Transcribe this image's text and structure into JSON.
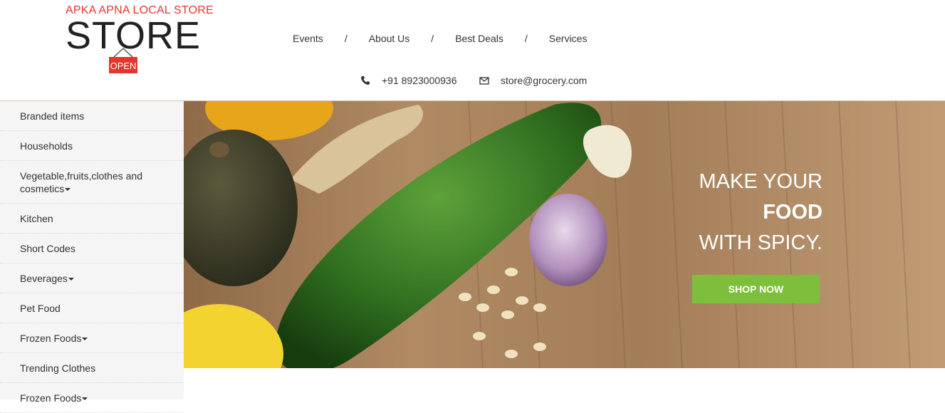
{
  "brand": {
    "tagline": "APKA APNA LOCAL STORE",
    "name": "STORE",
    "sign_text": "OPEN"
  },
  "nav": {
    "items": [
      "Events",
      "About Us",
      "Best Deals",
      "Services"
    ],
    "separator": "/"
  },
  "contact": {
    "phone": "+91 8923000936",
    "email": "store@grocery.com",
    "phone_icon": "phone-icon",
    "email_icon": "envelope-icon"
  },
  "sidebar": {
    "items": [
      {
        "label": "Branded items",
        "dropdown": false
      },
      {
        "label": "Households",
        "dropdown": false
      },
      {
        "label": "Vegetable,fruits,clothes and cosmetics",
        "dropdown": true
      },
      {
        "label": "Kitchen",
        "dropdown": false
      },
      {
        "label": "Short Codes",
        "dropdown": false
      },
      {
        "label": "Beverages",
        "dropdown": true
      },
      {
        "label": "Pet Food",
        "dropdown": false
      },
      {
        "label": "Frozen Foods",
        "dropdown": true
      },
      {
        "label": "Trending Clothes",
        "dropdown": false
      },
      {
        "label": "Frozen Foods",
        "dropdown": true
      }
    ]
  },
  "banner": {
    "line1": "MAKE YOUR",
    "line2": "FOOD",
    "line3": "WITH SPICY.",
    "cta": "SHOP NOW"
  },
  "colors": {
    "brand_red": "#e4352f",
    "cta_green": "#7dbf3a",
    "sidebar_bg": "#f5f5f5"
  }
}
